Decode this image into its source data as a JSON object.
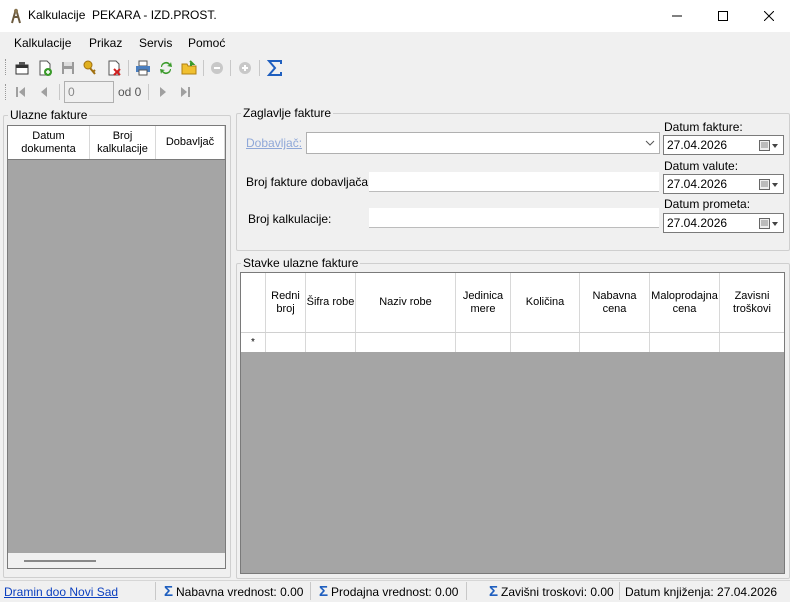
{
  "window": {
    "title": "Kalkulacije  PEKARA - IZD.PROST.",
    "minimize_glyph": "—",
    "close_glyph": "✕"
  },
  "menu": [
    "Kalkulacije",
    "Prikaz",
    "Servis",
    "Pomoć"
  ],
  "toolbar": {
    "icons": [
      "new-window-icon",
      "add-document-icon",
      "save-icon",
      "key-icon",
      "delete-document-icon",
      "print-icon",
      "refresh-icon",
      "open-folder-icon",
      "remove-circle-icon",
      "add-circle-icon",
      "sigma-icon"
    ]
  },
  "navigator": {
    "position_value": "0",
    "of_label": "od 0"
  },
  "left_panel": {
    "title": "Ulazne fakture",
    "columns": [
      "Datum dokumenta",
      "Broj kalkulacije",
      "Dobavljač"
    ]
  },
  "header_panel": {
    "title": "Zaglavlje fakture",
    "supplier_label": "Dobavljač:",
    "supplier_value": "",
    "invoice_no_label": "Broj fakture dobavljača:",
    "invoice_no_value": "",
    "calc_no_label": "Broj kalkulacije:",
    "calc_no_value": "",
    "invoice_date_label": "Datum fakture:",
    "invoice_date": "27.04.2026",
    "value_date_label": "Datum valute:",
    "value_date": "27.04.2026",
    "turnover_date_label": "Datum prometa:",
    "turnover_date": "27.04.2026"
  },
  "items_panel": {
    "title": "Stavke ulazne fakture",
    "columns": [
      "Redni broj",
      "Šifra robe",
      "Naziv robe",
      "Jedinica mere",
      "Količina",
      "Nabavna cena",
      "Maloprodajna cena",
      "Zavisni troškovi"
    ],
    "new_row_marker": "*"
  },
  "statusbar": {
    "company_link": "Dramin doo Novi Sad",
    "purchase_value": "Nabavna vrednost: 0.00",
    "sales_value": "Prodajna vrednost: 0.00",
    "dependent_costs": "Zavišni troskovi: 0.00",
    "posting_date": "Datum knjiženja: 27.04.2026",
    "sigma_glyph": "Σ"
  },
  "colors": {
    "grid_background": "#a5a5a5",
    "link": "#0b3fbf",
    "sigma": "#1f5fbf"
  }
}
